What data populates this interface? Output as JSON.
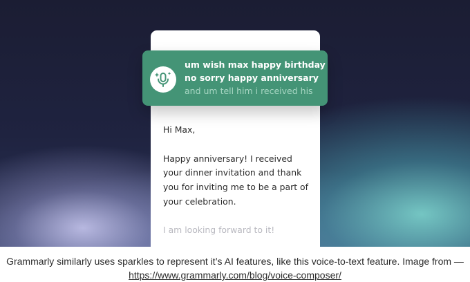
{
  "document": {
    "greeting": "Hi Max,",
    "paragraph_lines": [
      "Happy anniversary! I received",
      "your dinner invitation and thank",
      "you for inviting me to be a part of"
    ],
    "paragraph_faded_line": "your celebration.",
    "closing": "I am looking forward to it!"
  },
  "voice_composer": {
    "mic_icon": "microphone-sparkle-icon",
    "transcript_lines": [
      "um wish max happy birthday",
      "no sorry happy anniversary"
    ],
    "transcript_pending": "and um tell him i received his",
    "accent_color": "#449476"
  },
  "caption": {
    "text": "Grammarly similarly uses sparkles to represent it’s AI features, like this voice-to-text feature. Image from —",
    "link": "https://www.grammarly.com/blog/voice-composer/"
  }
}
